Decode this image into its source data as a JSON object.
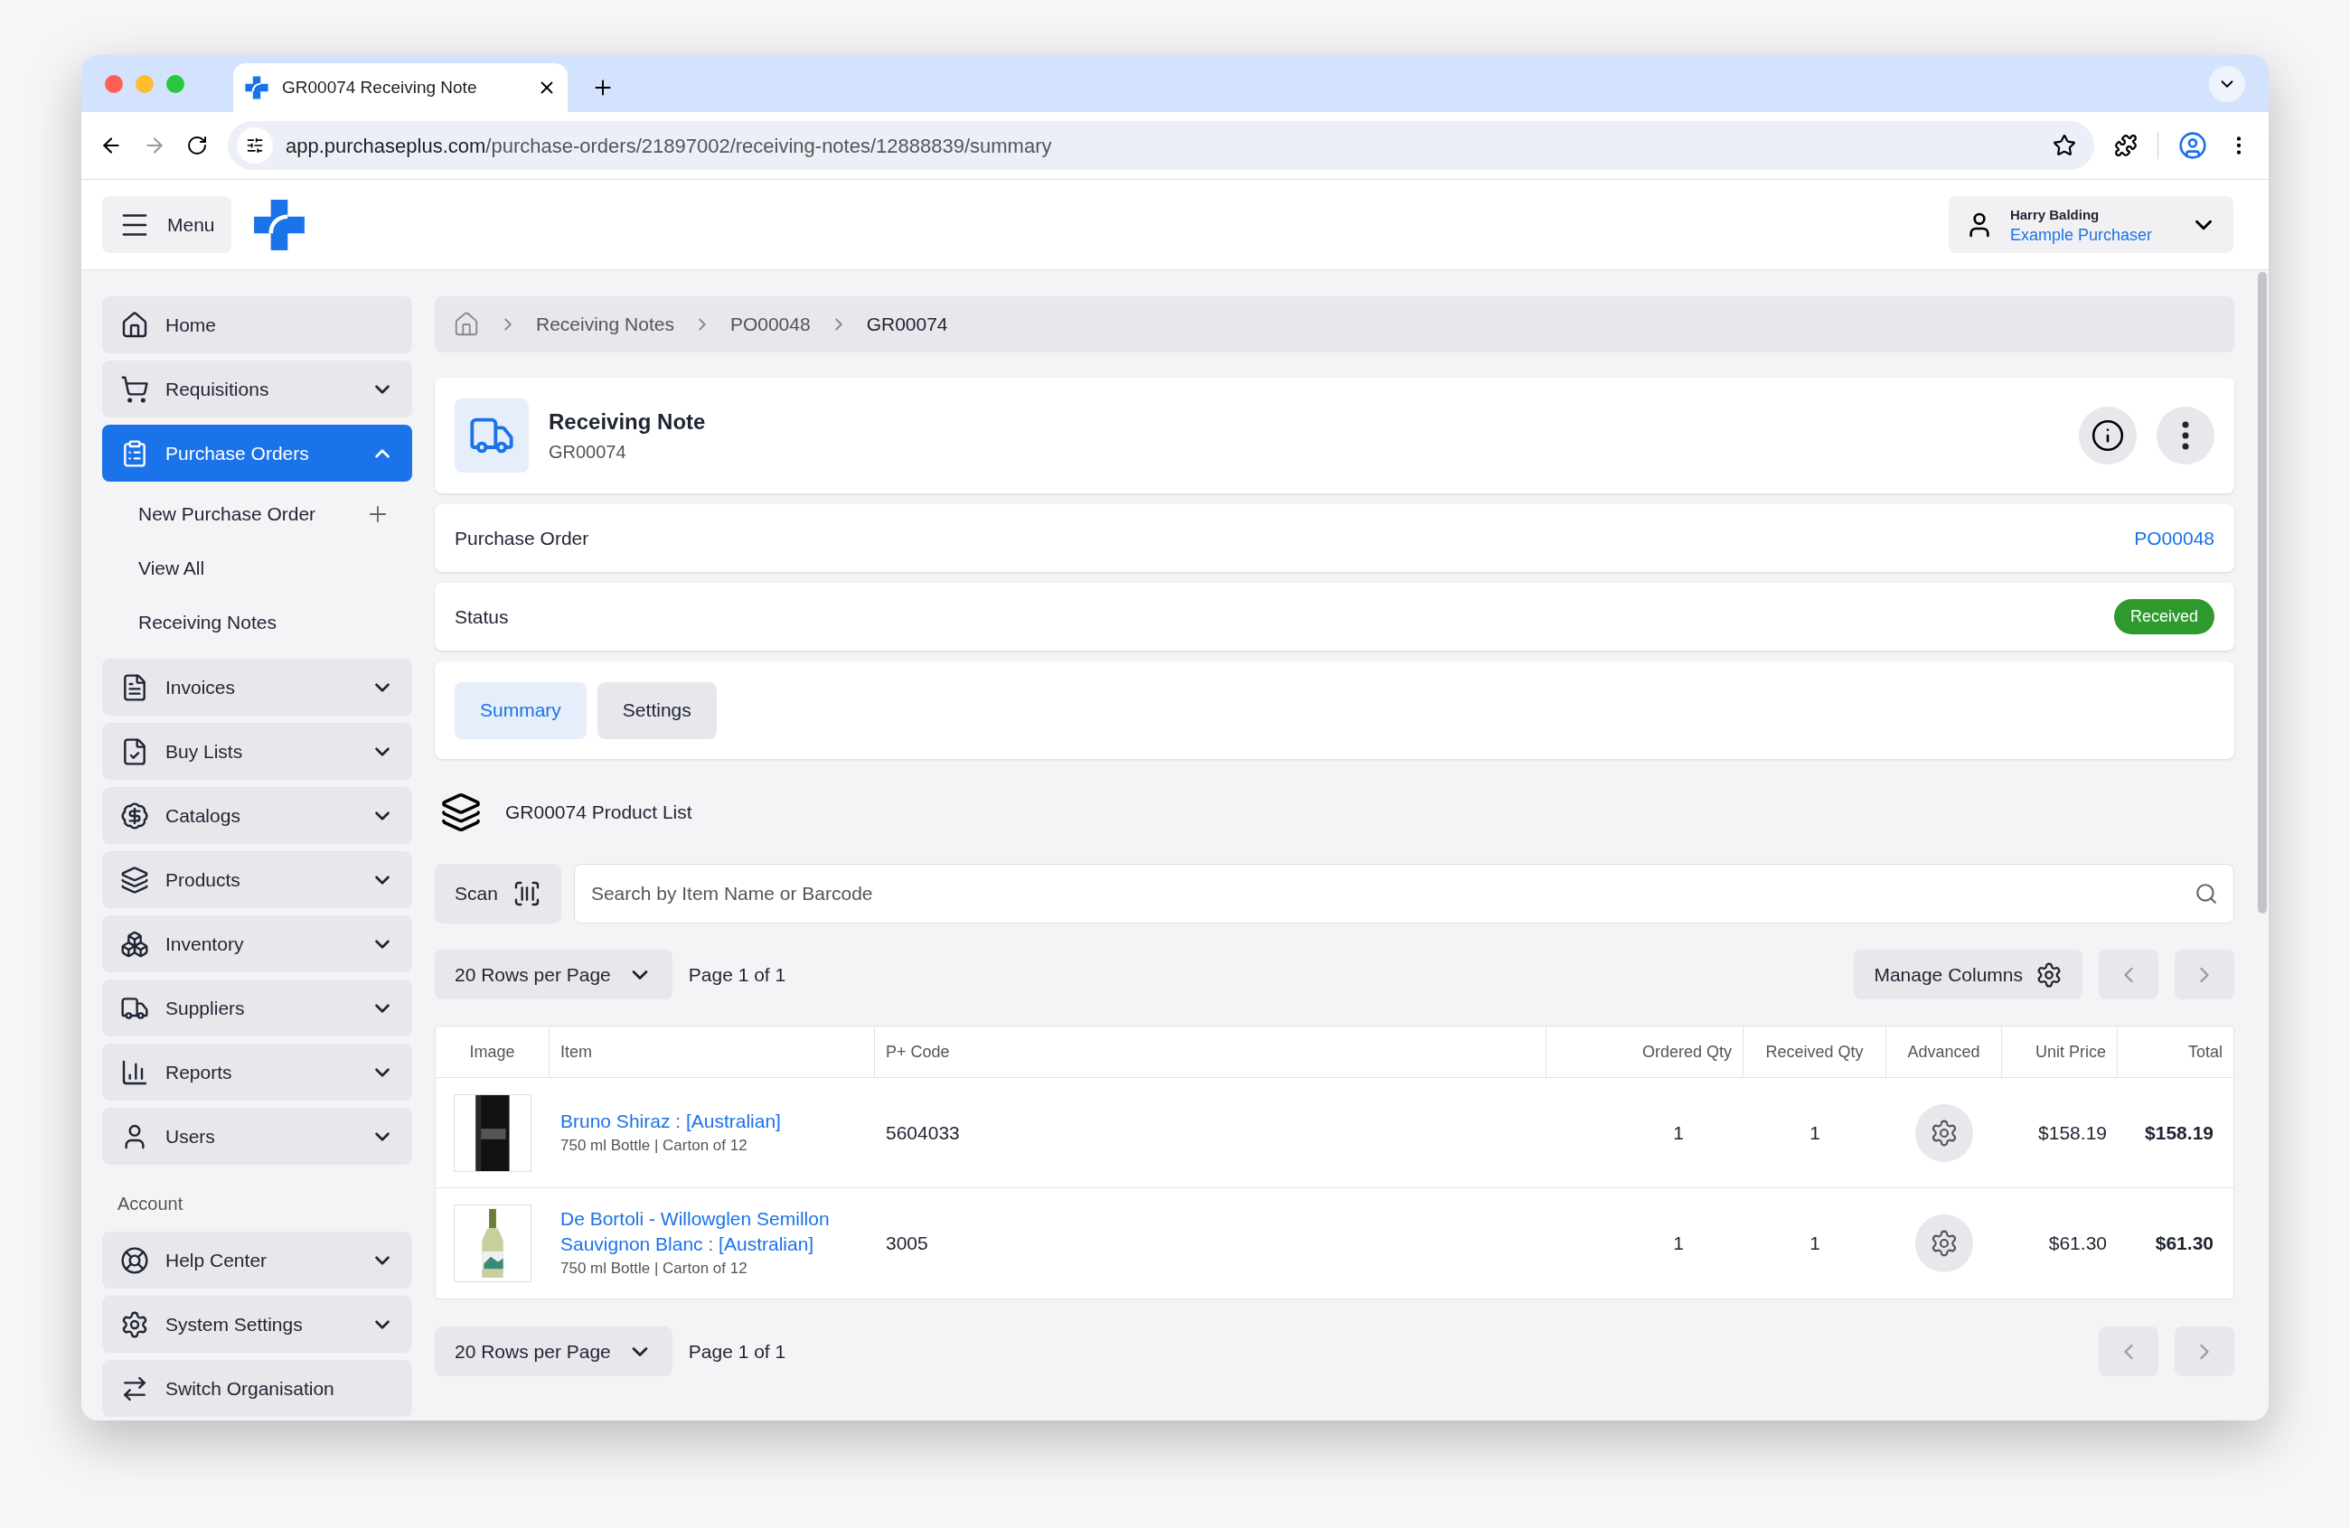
{
  "browser": {
    "tab_title": "GR00074 Receiving Note",
    "url_host": "app.purchaseplus.com",
    "url_path": "/purchase-orders/21897002/receiving-notes/12888839/summary"
  },
  "header": {
    "menu_label": "Menu",
    "user_name": "Harry Balding",
    "user_role": "Example Purchaser"
  },
  "sidebar": {
    "items": [
      {
        "label": "Home",
        "kind": "link",
        "selected": false
      },
      {
        "label": "Requisitions",
        "kind": "group",
        "selected": false,
        "expanded": false
      },
      {
        "label": "Purchase Orders",
        "kind": "group",
        "selected": true,
        "expanded": true,
        "children": [
          {
            "label": "New Purchase Order",
            "kind": "add"
          },
          {
            "label": "View All",
            "kind": "link"
          },
          {
            "label": "Receiving Notes",
            "kind": "link"
          }
        ]
      },
      {
        "label": "Invoices",
        "kind": "group",
        "selected": false,
        "expanded": false
      },
      {
        "label": "Buy Lists",
        "kind": "group",
        "selected": false,
        "expanded": false
      },
      {
        "label": "Catalogs",
        "kind": "group",
        "selected": false,
        "expanded": false
      },
      {
        "label": "Products",
        "kind": "group",
        "selected": false,
        "expanded": false
      },
      {
        "label": "Inventory",
        "kind": "group",
        "selected": false,
        "expanded": false
      },
      {
        "label": "Suppliers",
        "kind": "group",
        "selected": false,
        "expanded": false
      },
      {
        "label": "Reports",
        "kind": "group",
        "selected": false,
        "expanded": false
      },
      {
        "label": "Users",
        "kind": "group",
        "selected": false,
        "expanded": false
      }
    ],
    "account_label": "Account",
    "account_items": [
      {
        "label": "Help Center",
        "kind": "group",
        "expanded": false
      },
      {
        "label": "System Settings",
        "kind": "group",
        "expanded": false
      },
      {
        "label": "Switch Organisation",
        "kind": "link"
      }
    ]
  },
  "breadcrumbs": [
    "Receiving Notes",
    "PO00048",
    "GR00074"
  ],
  "note": {
    "title": "Receiving Note",
    "number": "GR00074"
  },
  "details": [
    {
      "label": "Purchase Order",
      "value": "PO00048",
      "kind": "link"
    },
    {
      "label": "Status",
      "value": "Received",
      "kind": "badge"
    }
  ],
  "tabs": [
    {
      "label": "Summary",
      "selected": true
    },
    {
      "label": "Settings",
      "selected": false
    }
  ],
  "product_list": {
    "title": "GR00074 Product List",
    "scan_label": "Scan",
    "search": {
      "placeholder": "Search by Item Name or Barcode"
    },
    "rows_per_page": "20 Rows per Page",
    "page": "Page 1 of 1",
    "manage_columns": "Manage Columns"
  },
  "table": {
    "columns": [
      "Image",
      "Item",
      "P+ Code",
      "Ordered Qty",
      "Received Qty",
      "Advanced",
      "Unit Price",
      "Total"
    ],
    "rows": [
      {
        "item": "Bruno Shiraz : [Australian]",
        "detail": "750 ml Bottle | Carton of 12",
        "code": "5604033",
        "ordered": "1",
        "received": "1",
        "unit_price": "$158.19",
        "total": "$158.19"
      },
      {
        "item": "De Bortoli - Willowglen Semillon Sauvignon Blanc : [Australian]",
        "detail": "750 ml Bottle | Carton of 12",
        "code": "3005",
        "ordered": "1",
        "received": "1",
        "unit_price": "$61.30",
        "total": "$61.30"
      }
    ]
  },
  "bottom_pager": {
    "rows_per_page": "20 Rows per Page",
    "page": "Page 1 of 1"
  }
}
